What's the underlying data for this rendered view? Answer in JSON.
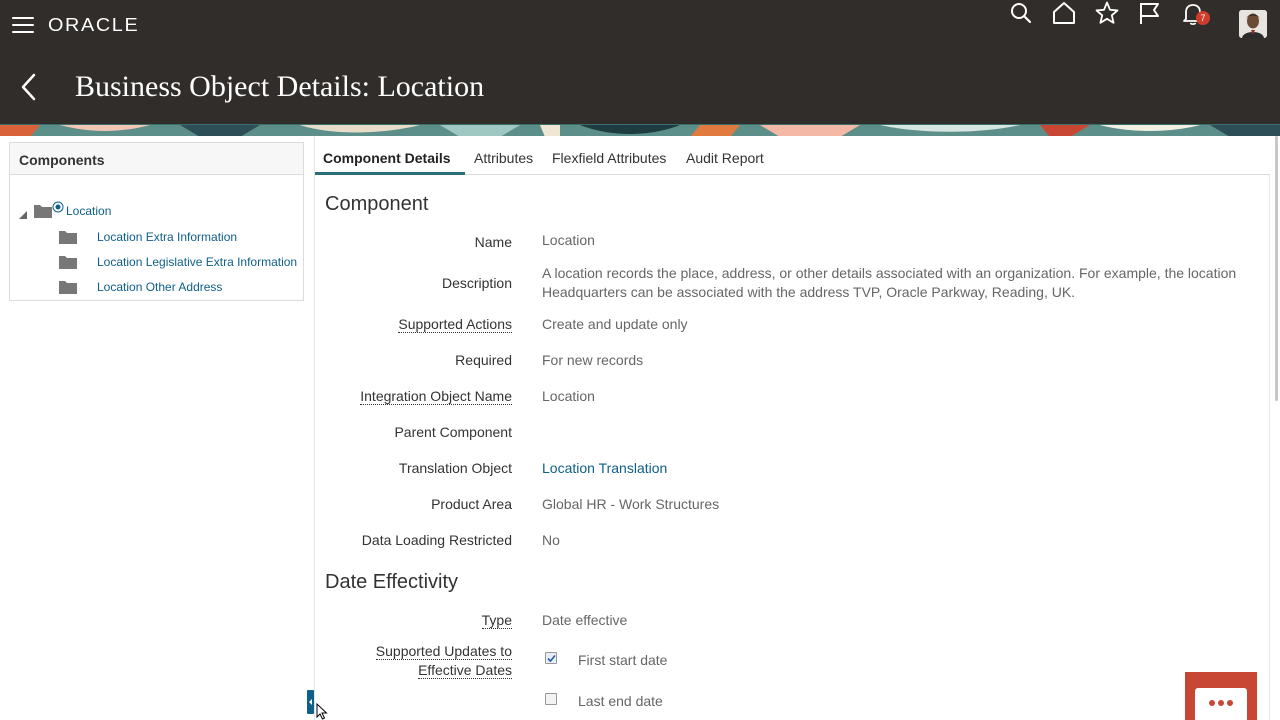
{
  "app": {
    "brand": "ORACLE",
    "notification_count": "7"
  },
  "page": {
    "title": "Business Object Details: Location"
  },
  "left_panel": {
    "title": "Components",
    "tree": [
      {
        "label": "Location",
        "level": 0,
        "selected": true
      },
      {
        "label": "Location Extra Information",
        "level": 1
      },
      {
        "label": "Location Legislative Extra Information",
        "level": 1
      },
      {
        "label": "Location Other Address",
        "level": 1
      }
    ]
  },
  "tabs": [
    {
      "label": "Component Details",
      "active": true
    },
    {
      "label": "Attributes"
    },
    {
      "label": "Flexfield Attributes"
    },
    {
      "label": "Audit Report"
    }
  ],
  "component": {
    "heading": "Component",
    "fields": {
      "name": {
        "label": "Name",
        "value": "Location"
      },
      "description": {
        "label": "Description",
        "value": "A location records the place, address, or other details associated with an organization. For example, the location Headquarters can be associated with the address TVP, Oracle Parkway, Reading, UK."
      },
      "supported_actions": {
        "label": "Supported Actions",
        "value": "Create and update only"
      },
      "required": {
        "label": "Required",
        "value": "For new records"
      },
      "integration_object_name": {
        "label": "Integration Object Name",
        "value": "Location"
      },
      "parent_component": {
        "label": "Parent Component",
        "value": ""
      },
      "translation_object": {
        "label": "Translation Object",
        "value": "Location Translation"
      },
      "product_area": {
        "label": "Product Area",
        "value": "Global HR - Work Structures"
      },
      "data_loading_restricted": {
        "label": "Data Loading Restricted",
        "value": "No"
      }
    }
  },
  "date_effectivity": {
    "heading": "Date Effectivity",
    "type": {
      "label": "Type",
      "value": "Date effective"
    },
    "supported_updates": {
      "label_line1": "Supported Updates to",
      "label_line2": "Effective Dates",
      "options": [
        {
          "label": "First start date",
          "checked": true
        },
        {
          "label": "Last end date",
          "checked": false
        }
      ]
    }
  },
  "colors": {
    "header_bg": "#312d2a",
    "link": "#0e5f8a",
    "tab_accent": "#2c6e77",
    "chat_button": "#c74634",
    "badge": "#d03b2a"
  },
  "icons": [
    "hamburger-icon",
    "search-icon",
    "home-icon",
    "star-icon",
    "flag-icon",
    "bell-icon",
    "back-arrow-icon",
    "folder-icon",
    "chat-icon"
  ]
}
